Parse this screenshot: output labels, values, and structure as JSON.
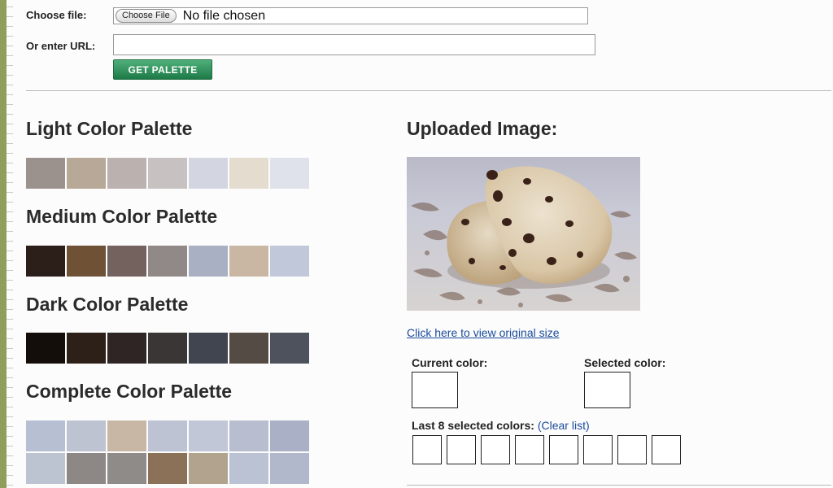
{
  "form": {
    "file_label": "Choose file:",
    "choose_button": "Choose File",
    "file_status": "No file chosen",
    "url_label": "Or enter URL:",
    "url_value": "",
    "submit_label": "GET PALETTE"
  },
  "palettes": {
    "light": {
      "title": "Light Color Palette",
      "colors": [
        "#9c928d",
        "#b8a897",
        "#bbb2b0",
        "#c7c1c1",
        "#d3d6e1",
        "#e3dccf",
        "#dfe2ea"
      ]
    },
    "medium": {
      "title": "Medium Color Palette",
      "colors": [
        "#2c1e19",
        "#6f5236",
        "#73625d",
        "#918987",
        "#a9b0c4",
        "#c9b7a4",
        "#c1c8da"
      ]
    },
    "dark": {
      "title": "Dark Color Palette",
      "colors": [
        "#140e0b",
        "#2c2019",
        "#2e2524",
        "#3b3636",
        "#41454f",
        "#544b45",
        "#4d525c"
      ]
    },
    "complete": {
      "title": "Complete Color Palette",
      "rows": [
        [
          "#b7bfd3",
          "#bec3d2",
          "#c8b7a4",
          "#bdc3d3",
          "#c2c7d8",
          "#b8bdd0",
          "#aab0c6"
        ],
        [
          "#bcc3d1",
          "#8d8785",
          "#8e8b89",
          "#8a7158",
          "#b1a38d",
          "#bac2d4",
          "#b1b8cb"
        ]
      ]
    }
  },
  "uploaded": {
    "title": "Uploaded Image:",
    "view_link": "Click here to view original size",
    "current_color_label": "Current color:",
    "selected_color_label": "Selected color:",
    "last_label": "Last 8 selected colors:",
    "clear_paren_open": "(",
    "clear_link": "Clear list",
    "clear_paren_close": ")"
  }
}
